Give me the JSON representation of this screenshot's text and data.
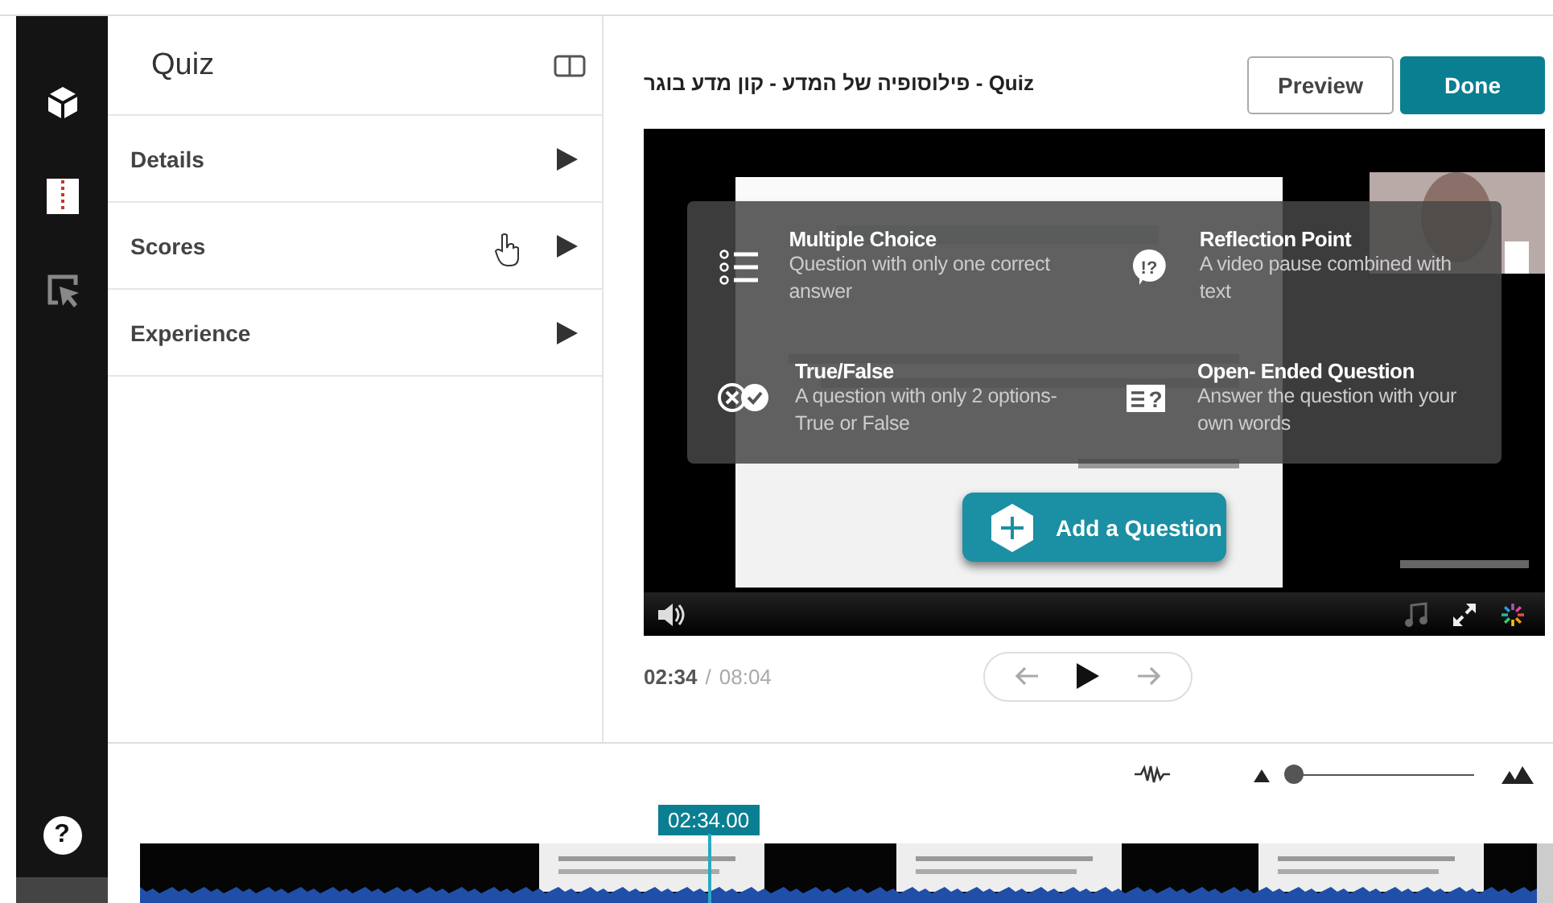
{
  "panel": {
    "title": "Quiz",
    "sections": [
      {
        "label": "Details",
        "expanded": false
      },
      {
        "label": "Scores",
        "expanded": false
      },
      {
        "label": "Experience",
        "expanded": false
      }
    ]
  },
  "header": {
    "title": "Quiz - פילוסופיה של המדע - קון מדע בוגר",
    "buttons": [
      {
        "label": "Preview",
        "kind": "secondary"
      },
      {
        "label": "Done",
        "kind": "primary"
      }
    ]
  },
  "question_types": [
    {
      "kind": "multiple_choice",
      "title": "Multiple Choice",
      "description": "Question with only one correct answer"
    },
    {
      "kind": "reflection",
      "title": "Reflection Point",
      "description": "A video pause combined with text",
      "icon_text": "!?"
    },
    {
      "kind": "true_false",
      "title": "True/False",
      "description": "A question with only 2 options- True or False"
    },
    {
      "kind": "open_ended",
      "title": "Open- Ended Question",
      "description": "Answer the question with your own words",
      "icon_text": "?"
    }
  ],
  "add_button": {
    "label": "Add a Question"
  },
  "player": {
    "current_time": "02:34",
    "separator": "/",
    "total_time": "08:04"
  },
  "timeline": {
    "playhead": "02:34.00",
    "zoom": {
      "level": 0
    }
  },
  "help": {
    "label": "?"
  }
}
